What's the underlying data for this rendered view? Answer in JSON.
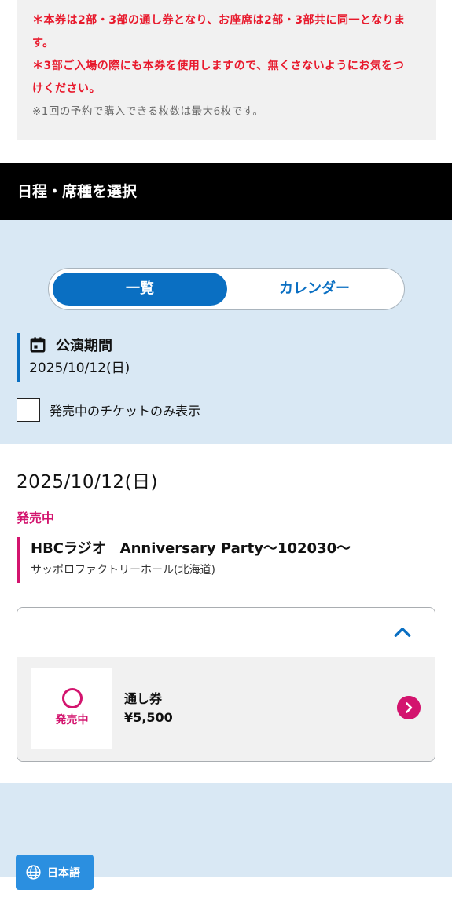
{
  "notice": {
    "line1": "＊本券は2部・3部の通し券となり、お座席は2部・3部共に同一となりま",
    "line2": "す。",
    "line3": "＊3部ご入場の際にも本券を使用しますので、無くさないようにお気をつ",
    "line4": "けください。",
    "line5": "※1回の予約で購入できる枚数は最大6枚です。"
  },
  "section": {
    "title": "日程・席種を選択"
  },
  "view_toggle": {
    "list_label": "一覧",
    "calendar_label": "カレンダー",
    "selected": "一覧"
  },
  "period": {
    "title": "公演期間",
    "date": "2025/10/12(日)",
    "icon": "calendar-icon"
  },
  "filter": {
    "label": "発売中のチケットのみ表示",
    "checked": false
  },
  "event": {
    "date": "2025/10/12(日)",
    "status": "発売中",
    "title": "HBCラジオ　Anniversary Party～102030～",
    "venue": "サッポロファクトリーホール(北海道)"
  },
  "ticket": {
    "status": "発売中",
    "status_mark": "circle",
    "name": "通し券",
    "price": "¥5,500"
  },
  "language": {
    "label": "日本語",
    "icon": "globe-icon"
  },
  "colors": {
    "brand_blue": "#0a6fc2",
    "sale_pink": "#d3146e",
    "warning_red": "#e8192c",
    "panel_blue": "#d9e8f4",
    "lang_button": "#2b8fe0"
  }
}
